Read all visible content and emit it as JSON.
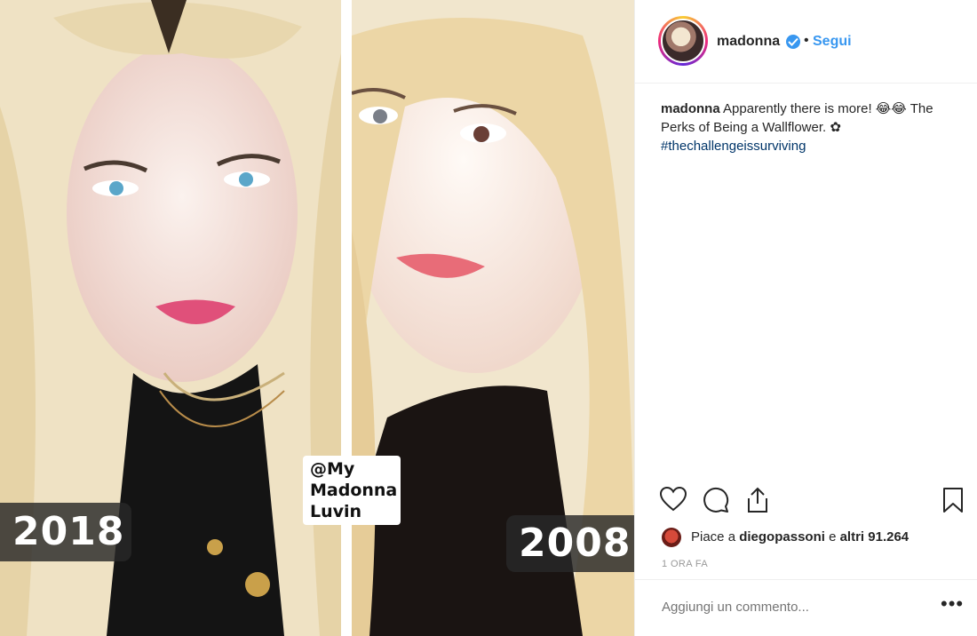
{
  "media": {
    "left_year": "2018",
    "right_year": "2008",
    "watermark": "@My Madonna Luvin"
  },
  "post": {
    "username": "madonna",
    "verified": true,
    "separator": "•",
    "follow_label": "Segui",
    "caption_user": "madonna",
    "caption_text": "Apparently there is more! 😂😂 The Perks of Being a Wallflower. ✿",
    "hashtag": "#thechallengeissurviving",
    "likes_prefix": "Piace a",
    "likes_user": "diegopassoni",
    "likes_connector": "e",
    "likes_others": "altri 91.264",
    "timestamp": "1 ORA FA",
    "comment_placeholder": "Aggiungi un commento...",
    "more_label": "•••"
  },
  "icons": {
    "like": "heart-icon",
    "comment": "comment-icon",
    "share": "share-icon",
    "save": "bookmark-icon",
    "verified": "verified-badge-icon"
  },
  "colors": {
    "link": "#3897f0",
    "hashtag": "#003569",
    "text": "#262626",
    "muted": "#999999"
  }
}
